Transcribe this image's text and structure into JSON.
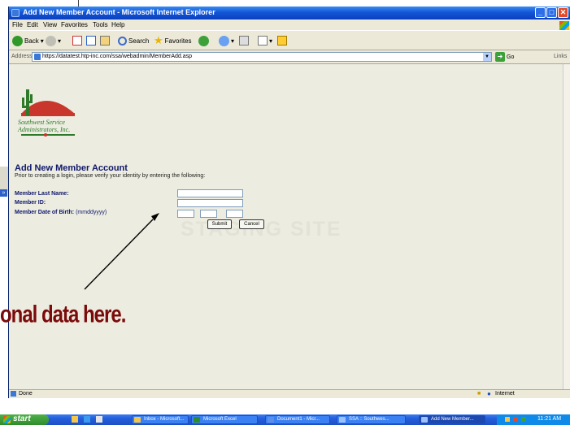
{
  "window": {
    "title": "Add New Member Account - Microsoft Internet Explorer",
    "minimize": "_",
    "maximize": "□",
    "close": "✕"
  },
  "menu": [
    "File",
    "Edit",
    "View",
    "Favorites",
    "Tools",
    "Help"
  ],
  "toolbar": {
    "back_label": "Back",
    "search_label": "Search",
    "favorites_label": "Favorites"
  },
  "address": {
    "label": "Address",
    "url": "https://datatest.htp-inc.com/ssa/webadmin/MemberAdd.asp",
    "go_label": "Go",
    "links_label": "Links"
  },
  "logo": {
    "line1": "Southwest Service",
    "line2": "Administrators, Inc."
  },
  "form": {
    "title": "Add New Member Account",
    "subtitle": "Prior to creating a login, please verify your identity by entering the following:",
    "last_name_label": "Member Last Name:",
    "member_id_label": "Member ID:",
    "dob_label": "Member Date of Birth:",
    "dob_hint": "(mmddyyyy)",
    "submit_label": "Submit",
    "cancel_label": "Cancel",
    "watermark": "STAGING SITE"
  },
  "annotation": {
    "text": "onal data here.",
    "echo_text": "..."
  },
  "status": {
    "text": "Done",
    "zone": "Internet"
  },
  "taskbar": {
    "start_label": "start",
    "tasks": [
      {
        "label": "Inbox - Microsoft...",
        "active": false
      },
      {
        "label": "Microsoft Excel",
        "active": false
      },
      {
        "label": "Document1 - Micr...",
        "active": false
      },
      {
        "label": "SSA :: Southwes...",
        "active": false
      },
      {
        "label": "Add New Member...",
        "active": true
      }
    ],
    "clock": "11:21 AM"
  },
  "colors": {
    "title_blue": "#10186b",
    "annotation_red": "#7b0b0b",
    "xp_blue": "#245edb",
    "start_green": "#2f8c2a"
  }
}
